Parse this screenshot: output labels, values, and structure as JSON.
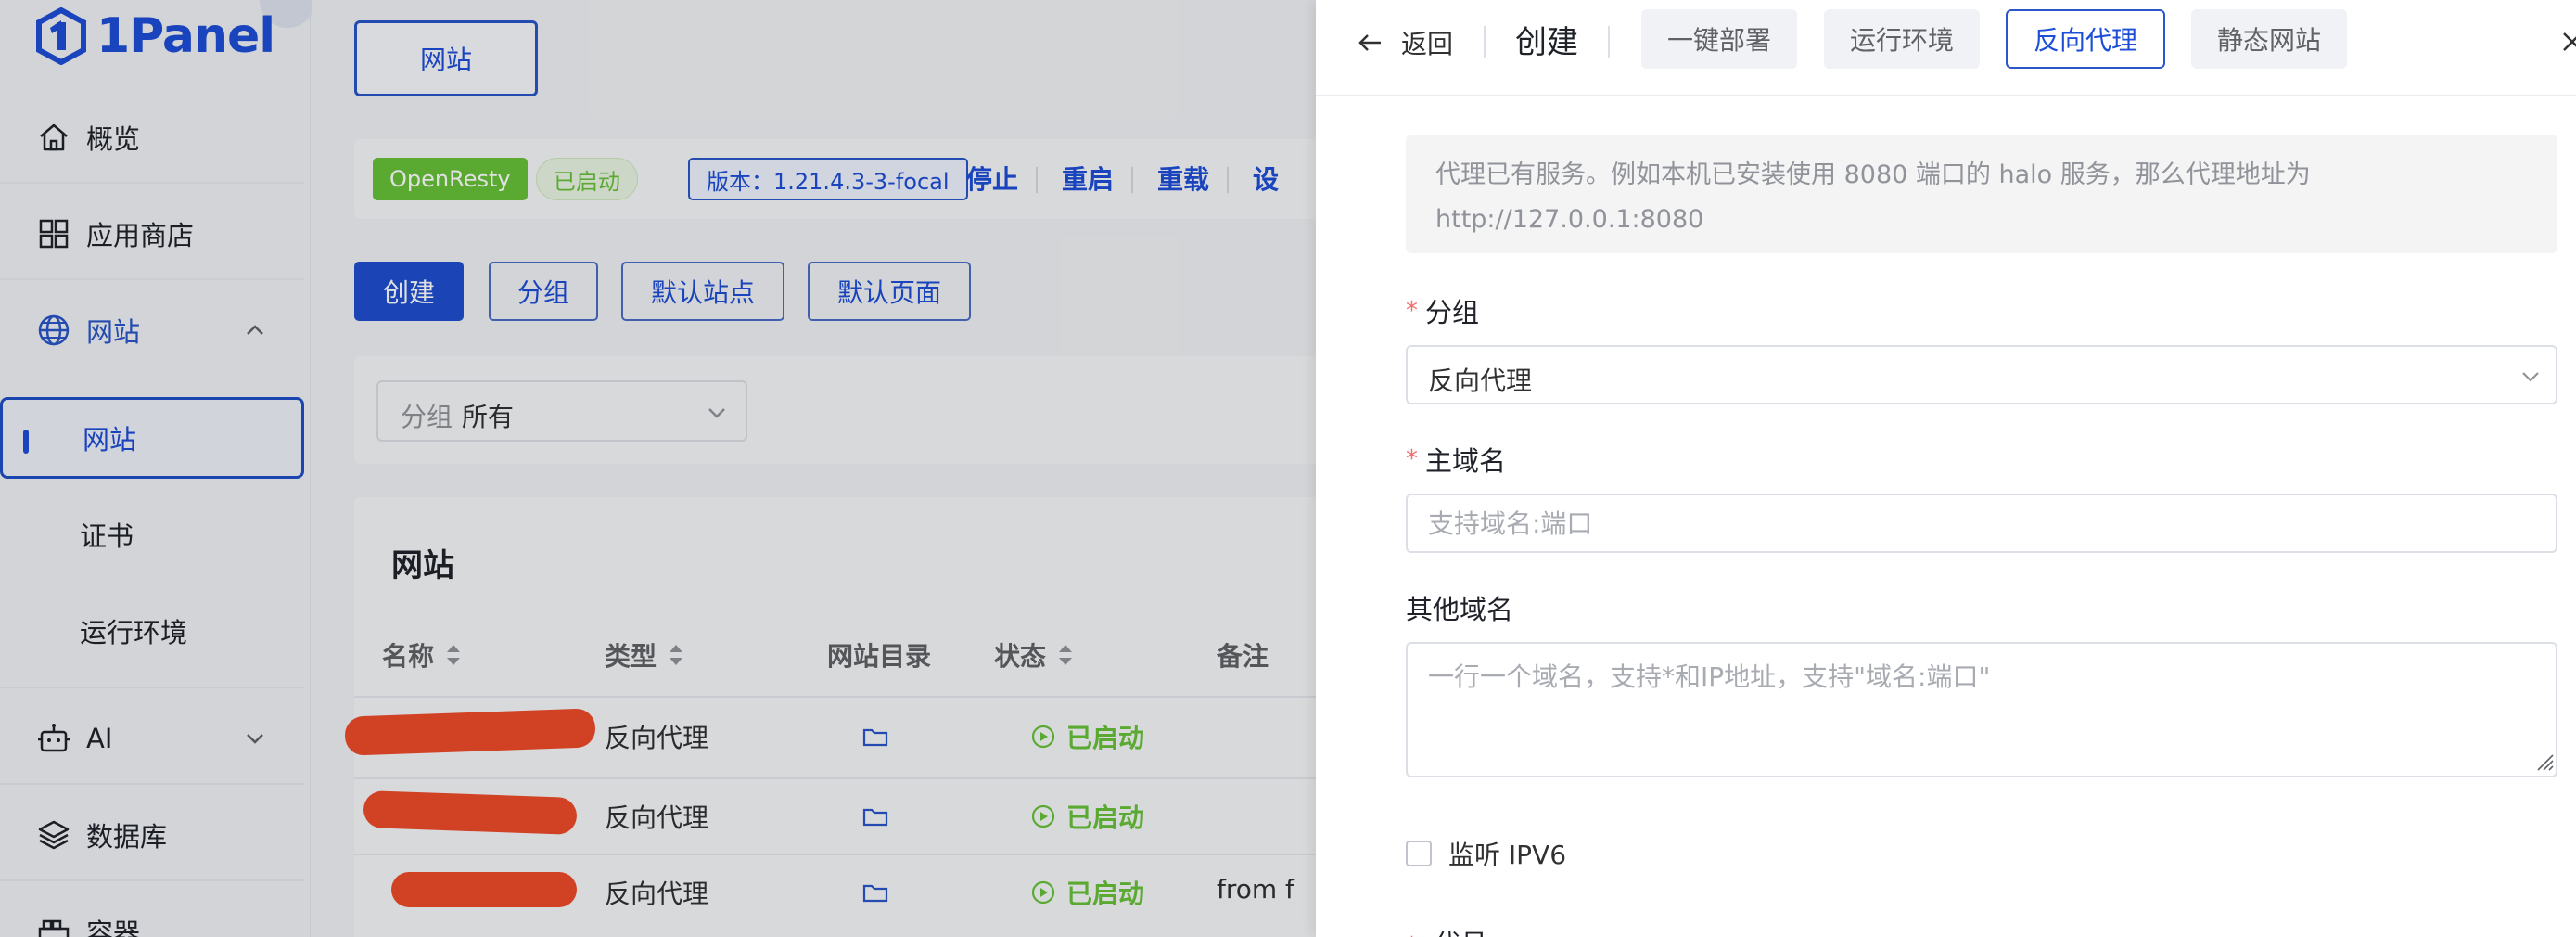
{
  "brand": {
    "name": "1Panel",
    "color": "#1d4ed8"
  },
  "sidebar": {
    "items": [
      {
        "label": "概览",
        "icon": "home-icon"
      },
      {
        "label": "应用商店",
        "icon": "grid-icon"
      },
      {
        "label": "网站",
        "icon": "globe-icon",
        "expanded": true
      },
      {
        "label": "AI",
        "icon": "robot-icon",
        "expanded": false
      },
      {
        "label": "数据库",
        "icon": "layers-icon"
      },
      {
        "label": "容器",
        "icon": "container-icon"
      }
    ],
    "sub_items": [
      {
        "label": "网站",
        "active": true
      },
      {
        "label": "证书"
      },
      {
        "label": "运行环境"
      }
    ]
  },
  "main": {
    "tab": "网站",
    "status": {
      "app": "OpenResty",
      "state": "已启动",
      "version": "版本：1.21.4.3-3-focal",
      "actions": [
        "停止",
        "重启",
        "重载",
        "设"
      ]
    },
    "buttons": [
      "创建",
      "分组",
      "默认站点",
      "默认页面"
    ],
    "filter": {
      "label": "分组",
      "value": "所有"
    },
    "list": {
      "title": "网站",
      "columns": [
        "名称",
        "类型",
        "网站目录",
        "状态",
        "备注"
      ],
      "rows": [
        {
          "type": "反向代理",
          "status": "已启动",
          "remark": ""
        },
        {
          "type": "反向代理",
          "status": "已启动",
          "remark": ""
        },
        {
          "type": "反向代理",
          "status": "已启动",
          "remark": "from f"
        }
      ]
    }
  },
  "drawer": {
    "back": "返回",
    "title": "创建",
    "tabs": [
      "一键部署",
      "运行环境",
      "反向代理",
      "静态网站"
    ],
    "active_tab": "反向代理",
    "tip_line1": "代理已有服务。例如本机已安装使用 8080 端口的 halo 服务，那么代理地址为",
    "tip_line2": "http://127.0.0.1:8080",
    "fields": {
      "group": {
        "label": "分组",
        "value": "反向代理"
      },
      "primary_domain": {
        "label": "主域名",
        "placeholder": "支持域名:端口"
      },
      "other_domains": {
        "label": "其他域名",
        "placeholder": "一行一个域名，支持*和IP地址，支持\"域名:端口\""
      },
      "ipv6": {
        "label": "监听 IPV6"
      },
      "next_label": "代号"
    }
  },
  "colors": {
    "accent": "#1d4ed8",
    "success": "#67c23a",
    "required": "#f56c6c",
    "redaction": "#ee4a2a"
  }
}
